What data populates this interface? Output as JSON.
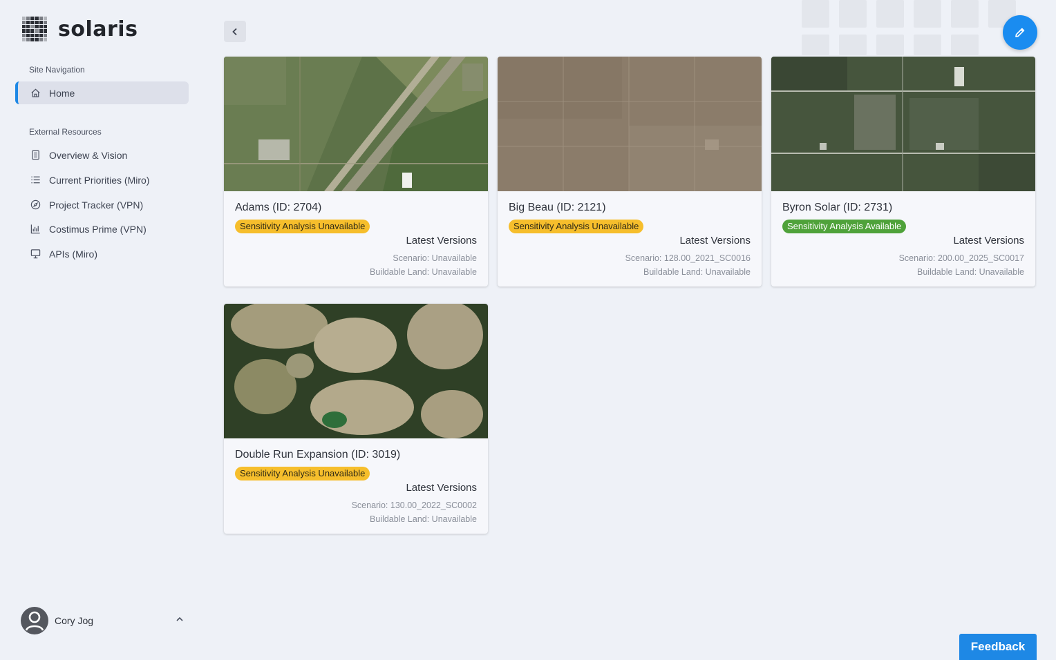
{
  "brand": {
    "name": "solaris"
  },
  "sidebar": {
    "site_nav_label": "Site Navigation",
    "home": {
      "label": "Home",
      "icon": "home-icon"
    },
    "external_label": "External Resources",
    "external_items": [
      {
        "label": "Overview & Vision",
        "icon": "document-icon"
      },
      {
        "label": "Current Priorities (Miro)",
        "icon": "list-icon"
      },
      {
        "label": "Project Tracker (VPN)",
        "icon": "compass-icon"
      },
      {
        "label": "Costimus Prime (VPN)",
        "icon": "bar-chart-icon"
      },
      {
        "label": "APIs (Miro)",
        "icon": "monitor-icon"
      }
    ],
    "user": {
      "name": "Cory Jog"
    }
  },
  "colors": {
    "accent": "#1e88e5",
    "badge_unavailable": "#f6be2c",
    "badge_available": "#4fa23a"
  },
  "projects": [
    {
      "title": "Adams (ID: 2704)",
      "badge": "Sensitivity Analysis Unavailable",
      "badge_status": "unavailable",
      "latest_label": "Latest Versions",
      "scenario": "Scenario: Unavailable",
      "buildable": "Buildable Land: Unavailable"
    },
    {
      "title": "Big Beau (ID: 2121)",
      "badge": "Sensitivity Analysis Unavailable",
      "badge_status": "unavailable",
      "latest_label": "Latest Versions",
      "scenario": "Scenario: 128.00_2021_SC0016",
      "buildable": "Buildable Land: Unavailable"
    },
    {
      "title": "Byron Solar (ID: 2731)",
      "badge": "Sensitivity Analysis Available",
      "badge_status": "available",
      "latest_label": "Latest Versions",
      "scenario": "Scenario: 200.00_2025_SC0017",
      "buildable": "Buildable Land: Unavailable"
    },
    {
      "title": "Double Run Expansion (ID: 3019)",
      "badge": "Sensitivity Analysis Unavailable",
      "badge_status": "unavailable",
      "latest_label": "Latest Versions",
      "scenario": "Scenario: 130.00_2022_SC0002",
      "buildable": "Buildable Land: Unavailable"
    }
  ],
  "feedback": {
    "label": "Feedback"
  }
}
